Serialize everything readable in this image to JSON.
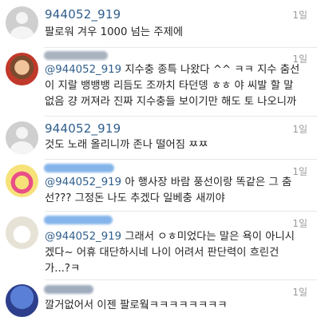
{
  "comments": [
    {
      "username": "944052_919",
      "time": "1일",
      "lines": [
        "팔로워 겨우 1000 넘는 주제에"
      ]
    },
    {
      "username": "",
      "time": "1일",
      "mention": "@944052_919",
      "lines": [
        " 지수충 종특 나왔다 ^^ ㅋㅋ 지수 춤선",
        "이 지랄 뱅뱅뱅 리듬도 조까치 타던뎅 ㅎㅎ 야 씨발 할 말",
        "없음 걍 꺼져라 진짜 지수충들 보이기만 해도 토 나오니까"
      ]
    },
    {
      "username": "944052_919",
      "time": "1일",
      "lines": [
        "것도 노래 올리니까 존나 떨어짐 ㅉㅉ"
      ]
    },
    {
      "username": "",
      "time": "1일",
      "mention": "@944052_919",
      "lines": [
        " 아 행사장 바람 풍선이랑 똑같은 그 춤",
        "선??? 그정돈 나도 추겠다 일베충 새끼야"
      ]
    },
    {
      "username": "",
      "time": "1일",
      "mention": "@944052_919",
      "lines": [
        " 그래서 ㅇㅎ미었다는 말은 욕이 아니시",
        "겠다~ 어휴 대단하시네 나이 어려서 판단력이 흐린건",
        "가...?ㅋ"
      ]
    },
    {
      "username": "",
      "time": "1일",
      "lines": [
        "깔거없어서 이젠 팔로웤ㅋㅋㅋㅋㅋㅋㅋㅋ"
      ]
    }
  ]
}
